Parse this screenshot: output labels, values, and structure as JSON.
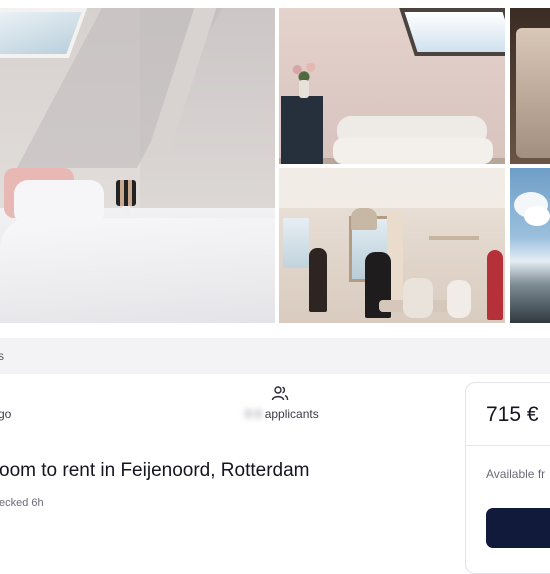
{
  "gallery": {
    "photos": [
      {
        "name": "bedroom"
      },
      {
        "name": "living-room-sofa"
      },
      {
        "name": "partial-right-top"
      },
      {
        "name": "living-room-group"
      },
      {
        "name": "partial-city-view"
      }
    ]
  },
  "band": {
    "text": "s"
  },
  "listing": {
    "posted_fragment": "go",
    "applicants_count_blurred": "0 0",
    "applicants_label": "applicants",
    "title_fragment": "oom to rent in Feijenoord, Rotterdam",
    "checked_fragment": "ecked 6h"
  },
  "price_card": {
    "price": "715 €",
    "available_fragment": "Available fr"
  }
}
